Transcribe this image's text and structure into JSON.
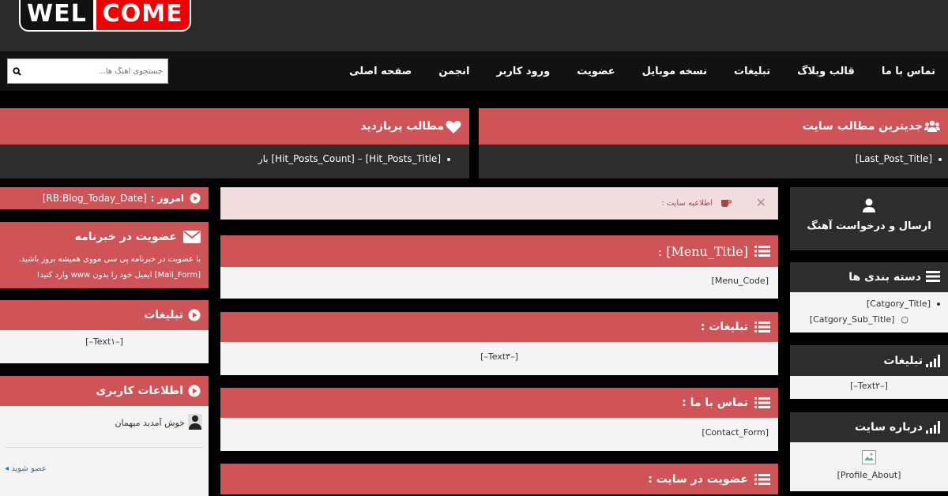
{
  "logo": {
    "part1": "WEL",
    "part2": "COME"
  },
  "nav": [
    "صفحه اصلی",
    "انجمن",
    "ورود کاربر",
    "عضویت",
    "نسخه موبایل",
    "تبلیغات",
    "قالب وبلاگ",
    "تماس با ما"
  ],
  "search": {
    "placeholder": "جستجوی آهنگ ها..."
  },
  "latest": {
    "title": "جدیترین مطالب سایت",
    "item": "[Last_Post_Title]"
  },
  "popular": {
    "title": "مطالب پربازدید",
    "item": "[Hit_Posts_Title] – [Hit_Posts_Count] بار"
  },
  "left": {
    "today": {
      "label": "امروز :",
      "value": "[RB:Blog_Today_Date]"
    },
    "newsletter": {
      "title": "عضویت در خبرنامه",
      "line1": "با عضویت در خبرنامه پی سی مووی همیشه بروز باشید.",
      "line2": "[Mail_Form] ایمیل خود را بدون www وارد کنید!"
    },
    "ads": {
      "title": "تبلیغات",
      "text": "[–Text۱–]"
    },
    "userinfo": {
      "title": "اطلاعات کاربری",
      "welcome": "خوش آمدید میهمان",
      "join": "عضو شوید"
    }
  },
  "center": {
    "notice": {
      "text": "اطلاعیه سایت :"
    },
    "menu": {
      "title": "[Menu_Title] :",
      "body": "[Menu_Code]"
    },
    "ads": {
      "title": "تبلیغات :",
      "body": "[–Text۳–]"
    },
    "contact": {
      "title": "تماس با ما :",
      "body": "[Contact_Form]"
    },
    "join": {
      "title": "عضویت در سایت :"
    }
  },
  "right": {
    "send": {
      "title": "ارسال و درخواست آهنگ"
    },
    "categories": {
      "title": "دسته بندی ها",
      "item": "[Catgory_Title]",
      "sub": "[Catgory_Sub_Title]"
    },
    "ads": {
      "title": "تبلیغات",
      "text": "[–Text۲–]"
    },
    "about": {
      "title": "درباره سایت",
      "text": "[Profile_About]"
    }
  },
  "colors": {
    "accent": "#ce5457",
    "dark": "#2d2d2d",
    "nav": "#121212",
    "notice_bg": "#f2dede"
  },
  "icons": [
    "search-icon",
    "users-icon",
    "heart-icon",
    "play-circle-icon",
    "envelope-icon",
    "close-icon",
    "coffee-icon",
    "list-icon",
    "user-icon",
    "bars-icon",
    "signal-icon",
    "broken-image-icon",
    "avatar-icon"
  ]
}
